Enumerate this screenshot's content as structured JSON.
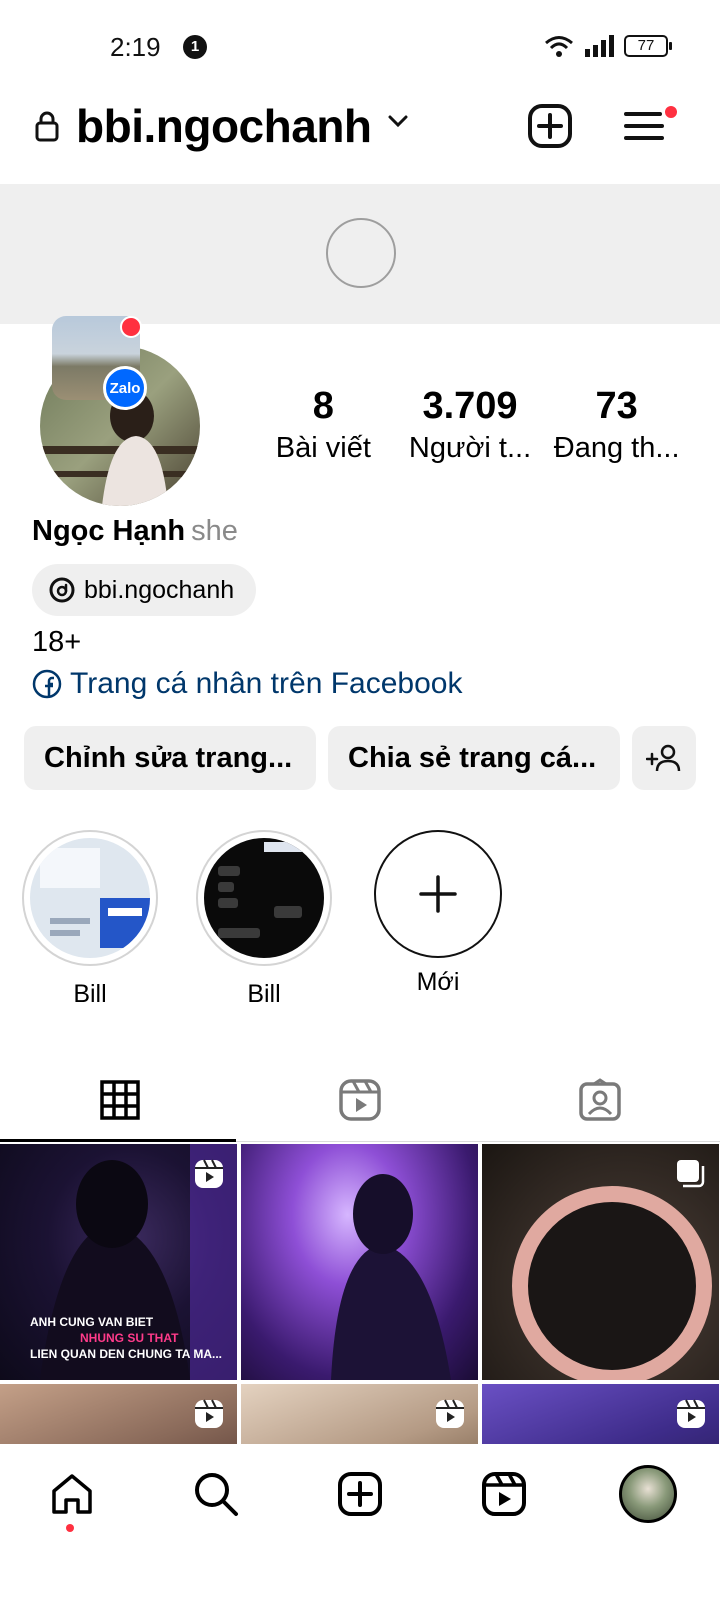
{
  "status_bar": {
    "time": "2:19",
    "notification_count": "1",
    "battery": "77"
  },
  "header": {
    "username": "bbi.ngochanh"
  },
  "profile": {
    "note_badge": "Zalo",
    "stats": [
      {
        "value": "8",
        "label": "Bài viết"
      },
      {
        "value": "3.709",
        "label": "Người t..."
      },
      {
        "value": "73",
        "label": "Đang th..."
      }
    ],
    "full_name": "Ngọc Hạnh",
    "pronoun": "she",
    "threads_handle": "bbi.ngochanh",
    "bio": "18+",
    "facebook_link": "Trang cá nhân trên Facebook"
  },
  "actions": {
    "edit": "Chỉnh sửa trang...",
    "share": "Chia sẻ trang cá..."
  },
  "highlights": [
    {
      "label": "Bill"
    },
    {
      "label": "Bill"
    },
    {
      "label": "Mới"
    }
  ],
  "posts": {
    "p1_caption_1": "ANH CUNG VAN BIET",
    "p1_caption_2": "NHUNG SU THAT",
    "p1_caption_3": "LIEN QUAN DEN CHUNG TA MA..."
  },
  "colors": {
    "accent_red": "#ff3040",
    "link_blue": "#00376b",
    "button_gray": "#efefef"
  }
}
